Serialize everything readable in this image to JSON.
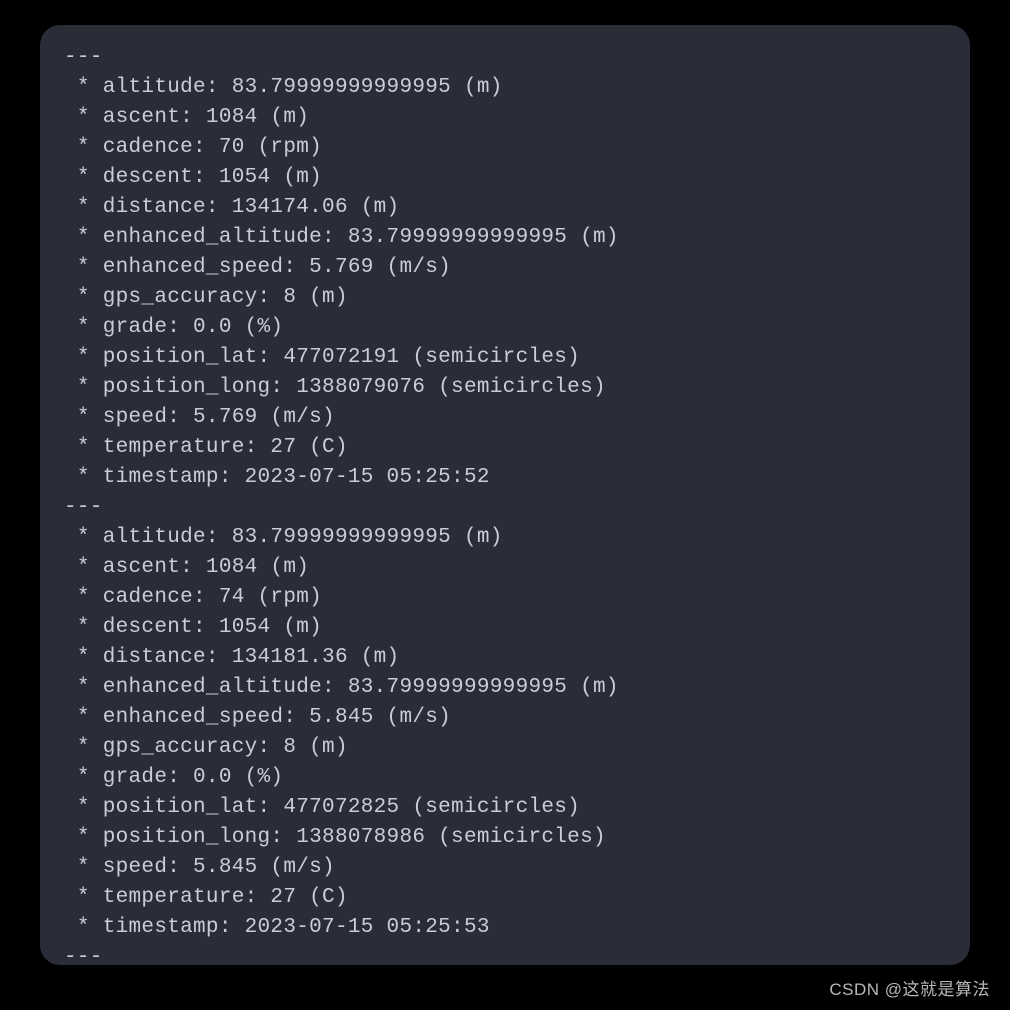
{
  "separator": "---",
  "records": [
    {
      "lines": [
        " * altitude: 83.79999999999995 (m)",
        " * ascent: 1084 (m)",
        " * cadence: 70 (rpm)",
        " * descent: 1054 (m)",
        " * distance: 134174.06 (m)",
        " * enhanced_altitude: 83.79999999999995 (m)",
        " * enhanced_speed: 5.769 (m/s)",
        " * gps_accuracy: 8 (m)",
        " * grade: 0.0 (%)",
        " * position_lat: 477072191 (semicircles)",
        " * position_long: 1388079076 (semicircles)",
        " * speed: 5.769 (m/s)",
        " * temperature: 27 (C)",
        " * timestamp: 2023-07-15 05:25:52"
      ]
    },
    {
      "lines": [
        " * altitude: 83.79999999999995 (m)",
        " * ascent: 1084 (m)",
        " * cadence: 74 (rpm)",
        " * descent: 1054 (m)",
        " * distance: 134181.36 (m)",
        " * enhanced_altitude: 83.79999999999995 (m)",
        " * enhanced_speed: 5.845 (m/s)",
        " * gps_accuracy: 8 (m)",
        " * grade: 0.0 (%)",
        " * position_lat: 477072825 (semicircles)",
        " * position_long: 1388078986 (semicircles)",
        " * speed: 5.845 (m/s)",
        " * temperature: 27 (C)",
        " * timestamp: 2023-07-15 05:25:53"
      ]
    }
  ],
  "structured": [
    {
      "altitude": {
        "value": "83.79999999999995",
        "unit": "m"
      },
      "ascent": {
        "value": "1084",
        "unit": "m"
      },
      "cadence": {
        "value": "70",
        "unit": "rpm"
      },
      "descent": {
        "value": "1054",
        "unit": "m"
      },
      "distance": {
        "value": "134174.06",
        "unit": "m"
      },
      "enhanced_altitude": {
        "value": "83.79999999999995",
        "unit": "m"
      },
      "enhanced_speed": {
        "value": "5.769",
        "unit": "m/s"
      },
      "gps_accuracy": {
        "value": "8",
        "unit": "m"
      },
      "grade": {
        "value": "0.0",
        "unit": "%"
      },
      "position_lat": {
        "value": "477072191",
        "unit": "semicircles"
      },
      "position_long": {
        "value": "1388079076",
        "unit": "semicircles"
      },
      "speed": {
        "value": "5.769",
        "unit": "m/s"
      },
      "temperature": {
        "value": "27",
        "unit": "C"
      },
      "timestamp": "2023-07-15 05:25:52"
    },
    {
      "altitude": {
        "value": "83.79999999999995",
        "unit": "m"
      },
      "ascent": {
        "value": "1084",
        "unit": "m"
      },
      "cadence": {
        "value": "74",
        "unit": "rpm"
      },
      "descent": {
        "value": "1054",
        "unit": "m"
      },
      "distance": {
        "value": "134181.36",
        "unit": "m"
      },
      "enhanced_altitude": {
        "value": "83.79999999999995",
        "unit": "m"
      },
      "enhanced_speed": {
        "value": "5.845",
        "unit": "m/s"
      },
      "gps_accuracy": {
        "value": "8",
        "unit": "m"
      },
      "grade": {
        "value": "0.0",
        "unit": "%"
      },
      "position_lat": {
        "value": "477072825",
        "unit": "semicircles"
      },
      "position_long": {
        "value": "1388078986",
        "unit": "semicircles"
      },
      "speed": {
        "value": "5.845",
        "unit": "m/s"
      },
      "temperature": {
        "value": "27",
        "unit": "C"
      },
      "timestamp": "2023-07-15 05:25:53"
    }
  ],
  "watermark": "CSDN @这就是算法"
}
